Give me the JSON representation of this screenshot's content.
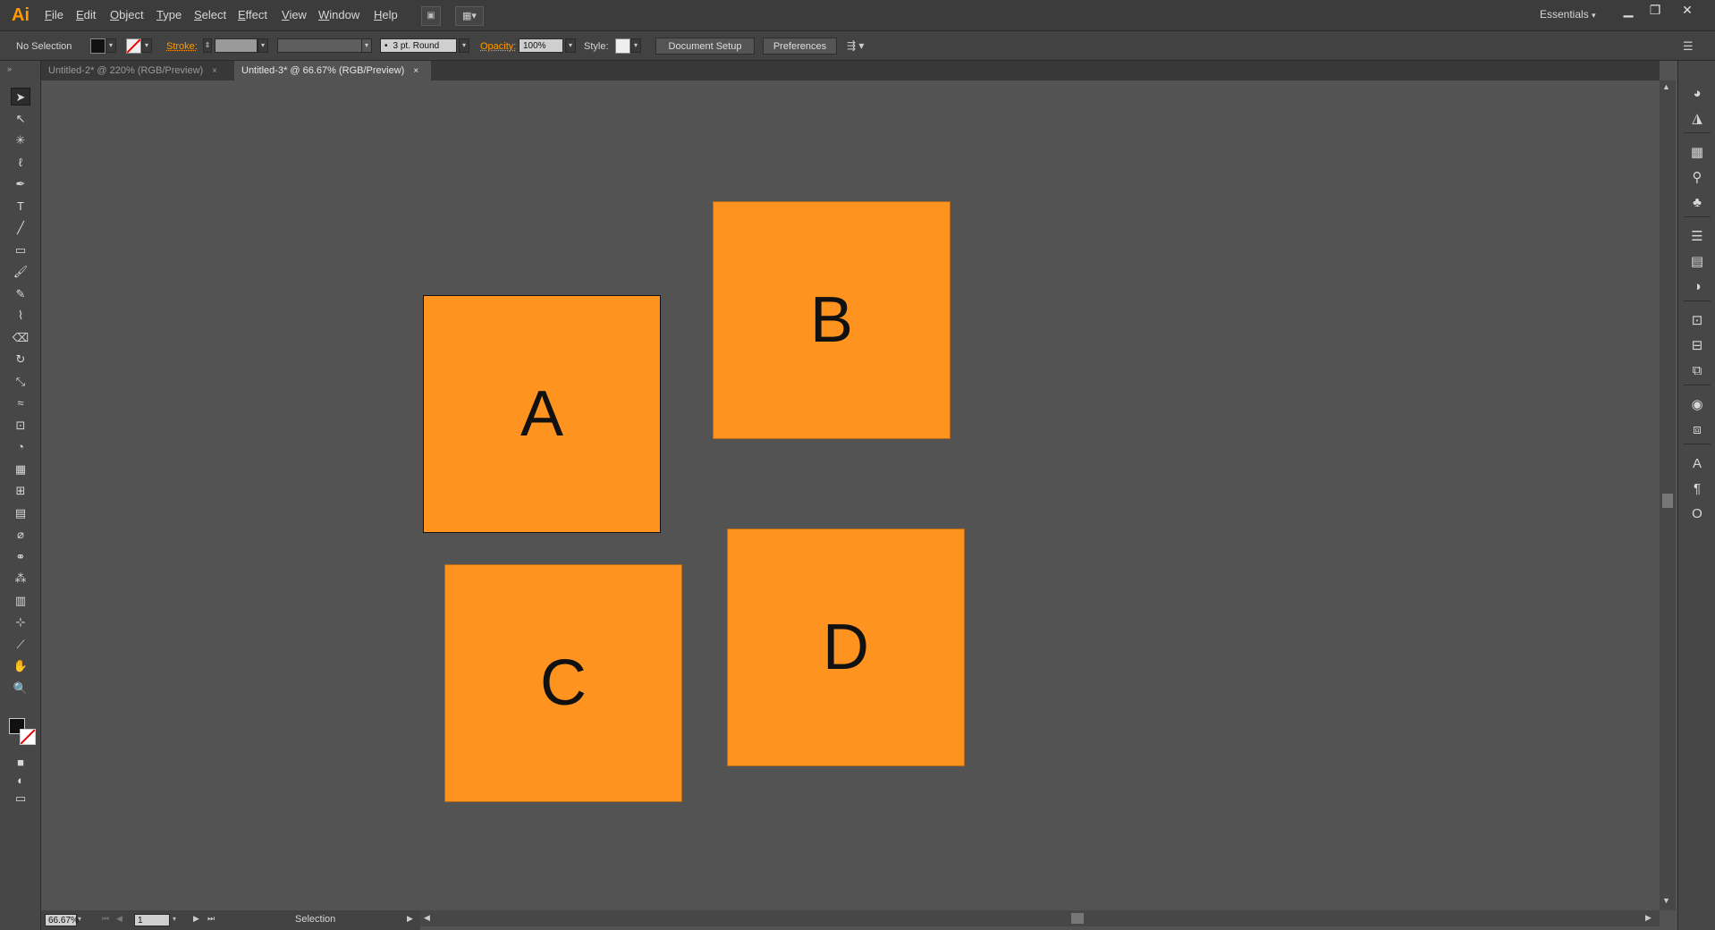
{
  "app": {
    "logo": "Ai",
    "workspace": "Essentials",
    "window_controls": [
      "minimize-icon",
      "restore-icon",
      "close-icon"
    ]
  },
  "menu": [
    "File",
    "Edit",
    "Object",
    "Type",
    "Select",
    "Effect",
    "View",
    "Window",
    "Help"
  ],
  "control_bar": {
    "selection_status": "No Selection",
    "stroke_label": "Stroke:",
    "brush_value": "3 pt. Round",
    "opacity_label": "Opacity:",
    "opacity_value": "100%",
    "style_label": "Style:",
    "document_setup": "Document Setup",
    "preferences": "Preferences"
  },
  "tabs": [
    {
      "label": "Untitled-2* @ 220% (RGB/Preview)",
      "close": "×",
      "active": false
    },
    {
      "label": "Untitled-3* @ 66.67% (RGB/Preview)",
      "close": "×",
      "active": true
    }
  ],
  "tools": [
    {
      "icon": "selection-tool-icon",
      "glyph": "➤"
    },
    {
      "icon": "direct-selection-tool-icon",
      "glyph": "↖"
    },
    {
      "icon": "magic-wand-tool-icon",
      "glyph": "✳"
    },
    {
      "icon": "lasso-tool-icon",
      "glyph": "ℓ"
    },
    {
      "icon": "pen-tool-icon",
      "glyph": "✒"
    },
    {
      "icon": "type-tool-icon",
      "glyph": "T"
    },
    {
      "icon": "line-tool-icon",
      "glyph": "╱"
    },
    {
      "icon": "rectangle-tool-icon",
      "glyph": "▭"
    },
    {
      "icon": "paintbrush-tool-icon",
      "glyph": "🖌"
    },
    {
      "icon": "pencil-tool-icon",
      "glyph": "✎"
    },
    {
      "icon": "blob-brush-tool-icon",
      "glyph": "⌇"
    },
    {
      "icon": "eraser-tool-icon",
      "glyph": "⌫"
    },
    {
      "icon": "rotate-tool-icon",
      "glyph": "↻"
    },
    {
      "icon": "scale-tool-icon",
      "glyph": "⤡"
    },
    {
      "icon": "warp-tool-icon",
      "glyph": "≈"
    },
    {
      "icon": "free-transform-tool-icon",
      "glyph": "⊡"
    },
    {
      "icon": "shape-builder-tool-icon",
      "glyph": "◔"
    },
    {
      "icon": "perspective-grid-tool-icon",
      "glyph": "▦"
    },
    {
      "icon": "mesh-tool-icon",
      "glyph": "⊞"
    },
    {
      "icon": "gradient-tool-icon",
      "glyph": "▤"
    },
    {
      "icon": "eyedropper-tool-icon",
      "glyph": "⌀"
    },
    {
      "icon": "blend-tool-icon",
      "glyph": "⚭"
    },
    {
      "icon": "symbol-sprayer-tool-icon",
      "glyph": "⁂"
    },
    {
      "icon": "column-graph-tool-icon",
      "glyph": "▥"
    },
    {
      "icon": "artboard-tool-icon",
      "glyph": "⊹"
    },
    {
      "icon": "slice-tool-icon",
      "glyph": "⟋"
    },
    {
      "icon": "hand-tool-icon",
      "glyph": "✋"
    },
    {
      "icon": "zoom-tool-icon",
      "glyph": "🔍"
    }
  ],
  "canvas": {
    "shapes": [
      {
        "label": "A",
        "fill": "#ff9320",
        "selected": true
      },
      {
        "label": "B",
        "fill": "#ff9320",
        "selected": false
      },
      {
        "label": "C",
        "fill": "#ff9320",
        "selected": false
      },
      {
        "label": "D",
        "fill": "#ff9320",
        "selected": false
      }
    ]
  },
  "right_panels": [
    "color-panel-icon",
    "color-guide-panel-icon",
    "swatches-panel-icon",
    "brushes-panel-icon",
    "symbols-panel-icon",
    "stroke-panel-icon",
    "gradient-panel-icon",
    "transparency-panel-icon",
    "transform-panel-icon",
    "align-panel-icon",
    "pathfinder-panel-icon",
    "appearance-panel-icon",
    "graphic-styles-panel-icon",
    "character-panel-icon",
    "paragraph-panel-icon",
    "opentype-panel-icon"
  ],
  "status_bar": {
    "zoom": "66.67%",
    "artboard": "1",
    "tool_status": "Selection"
  },
  "colors": {
    "accent": "#ff9a00",
    "shape_fill": "#ff9320",
    "canvas": "#535353"
  }
}
